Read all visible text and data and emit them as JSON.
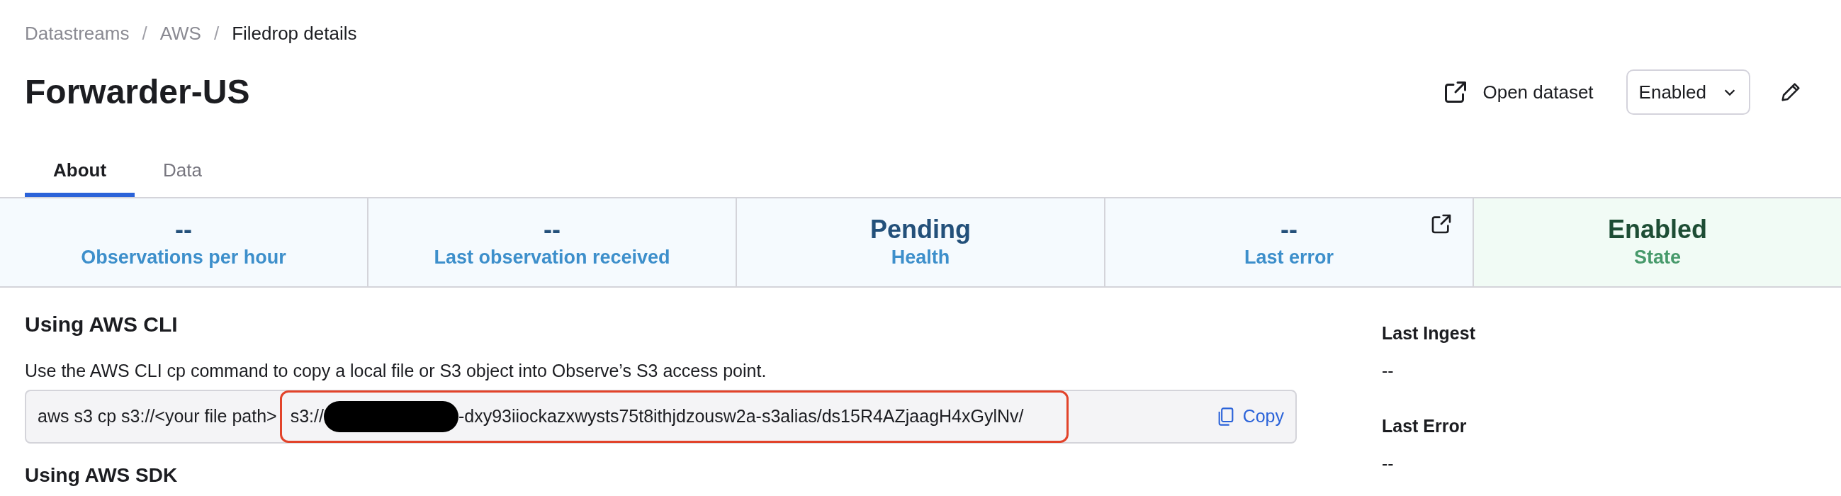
{
  "breadcrumb": [
    {
      "label": "Datastreams",
      "current": false
    },
    {
      "separator": "/",
      "label": "AWS",
      "current": false
    },
    {
      "separator": "/",
      "label": "Filedrop details",
      "current": true
    }
  ],
  "title": "Forwarder-US",
  "actions": {
    "open_dataset": "Open dataset",
    "state_select": "Enabled"
  },
  "tabs": [
    {
      "label": "About",
      "selected": true
    },
    {
      "label": "Data",
      "selected": false
    }
  ],
  "stats": [
    {
      "value": "--",
      "label": "Observations per hour",
      "kind": "info",
      "link": false
    },
    {
      "value": "--",
      "label": "Last observation received",
      "kind": "info",
      "link": false
    },
    {
      "value": "Pending",
      "label": "Health",
      "kind": "info",
      "link": false
    },
    {
      "value": "--",
      "label": "Last error",
      "kind": "info",
      "link": true
    },
    {
      "value": "Enabled",
      "label": "State",
      "kind": "success",
      "link": false
    }
  ],
  "cli": {
    "heading": "Using AWS CLI",
    "description": "Use the AWS CLI cp command to copy a local file or S3 object into Observe’s S3 access point.",
    "command_prefix": "aws s3 cp s3://<your file path>",
    "target_start": "s3://",
    "redacted": true,
    "target_end": "-dxy93iiockazxwysts75t8ithjdzousw2a-s3alias/ds15R4AZjaagH4xGylNv/",
    "highlighted": true,
    "copy": "Copy"
  },
  "sdk": {
    "heading": "Using AWS SDK"
  },
  "side": [
    {
      "label": "Last Ingest",
      "value": "--"
    },
    {
      "label": "Last Error",
      "value": "--"
    }
  ]
}
